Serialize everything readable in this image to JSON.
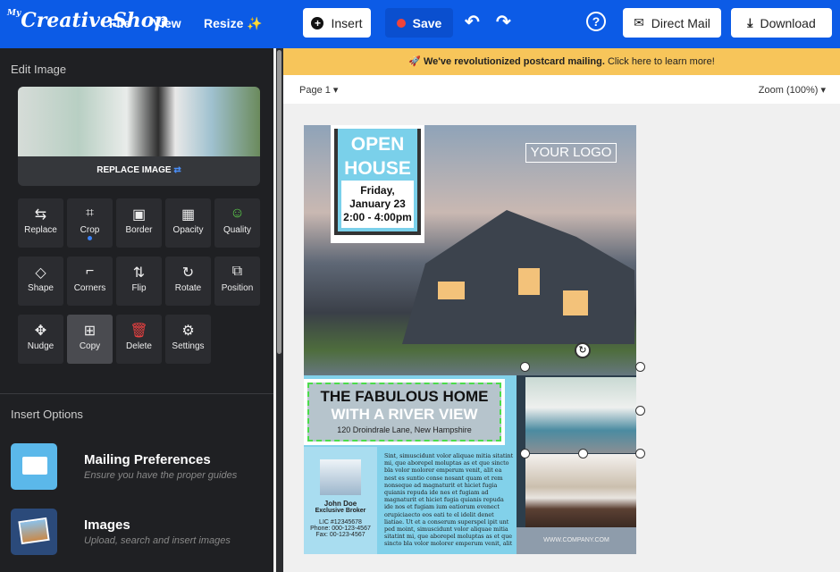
{
  "topbar": {
    "logo": "MyCreativeShop",
    "logo_small": "My",
    "logo_main": "CreativeShop",
    "menu": [
      "File",
      "View",
      "Resize"
    ],
    "insert": "Insert",
    "save": "Save",
    "direct_mail": "Direct Mail",
    "download": "Download",
    "accent": "#0c5be6"
  },
  "sidebar": {
    "title": "Edit Image",
    "replace_image": "REPLACE IMAGE",
    "tools": [
      {
        "label": "Replace",
        "icon": "⇆"
      },
      {
        "label": "Crop",
        "icon": "⌗"
      },
      {
        "label": "Border",
        "icon": "▣"
      },
      {
        "label": "Opacity",
        "icon": "▦"
      },
      {
        "label": "Quality",
        "icon": "☺"
      },
      {
        "label": "Shape",
        "icon": "◇"
      },
      {
        "label": "Corners",
        "icon": "⌐"
      },
      {
        "label": "Flip",
        "icon": "⇅"
      },
      {
        "label": "Rotate",
        "icon": "↻"
      },
      {
        "label": "Position",
        "icon": "⧉"
      },
      {
        "label": "Nudge",
        "icon": "✥"
      },
      {
        "label": "Copy",
        "icon": "⊞"
      },
      {
        "label": "Delete",
        "icon": "🗑"
      },
      {
        "label": "Settings",
        "icon": "⚙"
      }
    ],
    "insert_title": "Insert Options",
    "options": [
      {
        "title": "Mailing Preferences",
        "sub": "Ensure you have the proper guides"
      },
      {
        "title": "Images",
        "sub": "Upload, search and insert images"
      }
    ]
  },
  "banner": {
    "bold": "We've revolutionized postcard mailing.",
    "text": " Click here to learn more!"
  },
  "pagebar": {
    "page": "Page 1",
    "zoom": "Zoom (100%)"
  },
  "postcard": {
    "open": "OPEN",
    "house": "HOUSE",
    "day": "Friday,",
    "date": "January 23",
    "time": "2:00 - 4:00pm",
    "logo": "YOUR LOGO",
    "headline1": "THE FABULOUS HOME",
    "headline2": "WITH A RIVER VIEW",
    "address": "120 Droindrale Lane, New Hampshire",
    "agent_name": "John Doe",
    "agent_title": "Exclusive Broker",
    "lic": "LIC #12345678",
    "phone": "Phone: 000-123-4567",
    "fax": "Fax: 00-123-4567",
    "body": "Sint, simuscidunt volor aliquae mitia sitatint mi, que aborepel moluptas as et que sincto bla volor molorer emperum venit, alit ea nest es suntio conse nosant quam et rem nonseque ad magnaturit et hiciet fugia quianis repuda ide nes et fugiam ad magnaturit et hiciet fugia quianis repuda ide nos et fugiam ium eatiorum evenect orupiciaecto eos eati te el idelit denet liatiae. Ut et a conserum superspel ipit unt ped moint, simuscidunt volor aliquae mitia sitatint mi, que aborepel moluptas as et que sincto bla volor molorer emperum venit, alit",
    "website": "WWW.COMPANY.COM"
  }
}
